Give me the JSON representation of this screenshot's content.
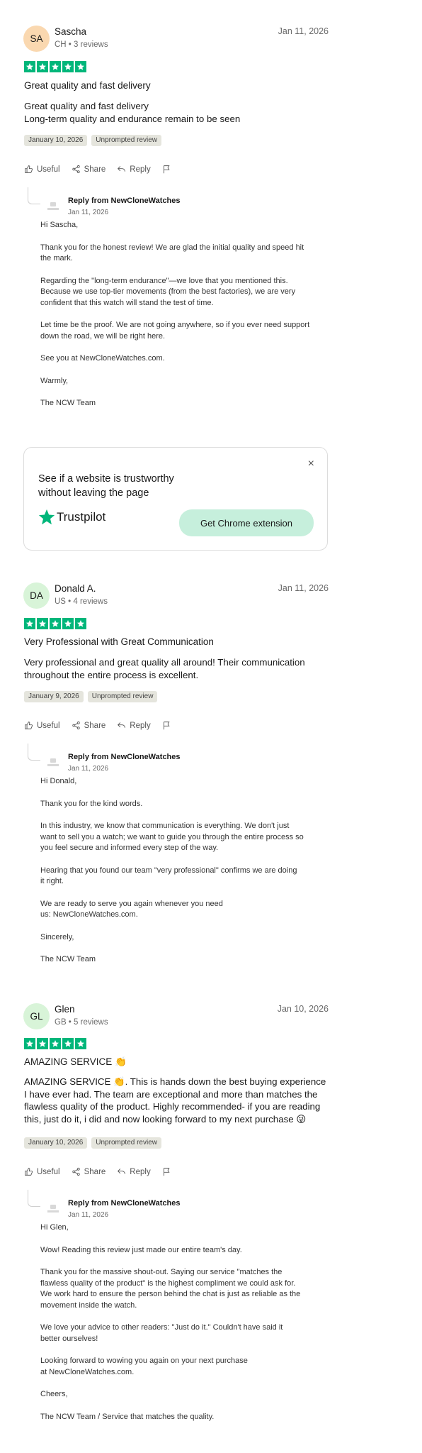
{
  "reviews": [
    {
      "initials": "SA",
      "avatar_color": "#fad8b0",
      "name": "Sascha",
      "meta": "CH • 3 reviews",
      "date": "Jan 11, 2026",
      "rating": 5,
      "title": "Great quality and fast delivery",
      "body": [
        "Great quality and fast delivery",
        "Long-term quality and endurance remain to be seen"
      ],
      "experience_date": "January 10, 2026",
      "tag": "Unprompted review",
      "actions": {
        "useful": "Useful",
        "share": "Share",
        "reply": "Reply"
      },
      "reply": {
        "from": "Reply from NewCloneWatches",
        "date": "Jan 11, 2026",
        "paragraphs": [
          [
            "Hi Sascha,"
          ],
          [
            "Thank you for the honest review! We are glad the initial quality and speed hit",
            "the mark."
          ],
          [
            "Regarding the \"long-term endurance\"—we love that you mentioned this.",
            "Because we use top-tier movements (from the best factories), we are very",
            "confident that this watch will stand the test of time."
          ],
          [
            "Let time be the proof. We are not going anywhere, so if you ever need support",
            "down the road, we will be right here."
          ],
          [
            "See you at NewCloneWatches.com."
          ],
          [
            "Warmly,"
          ],
          [
            "The NCW Team"
          ]
        ]
      }
    },
    {
      "initials": "DA",
      "avatar_color": "#d8f4d8",
      "name": "Donald A.",
      "meta": "US • 4 reviews",
      "date": "Jan 11, 2026",
      "rating": 5,
      "title": "Very Professional with Great Communication",
      "body": [
        "Very professional and great quality all around! Their communication",
        "throughout the entire process is excellent."
      ],
      "experience_date": "January 9, 2026",
      "tag": "Unprompted review",
      "actions": {
        "useful": "Useful",
        "share": "Share",
        "reply": "Reply"
      },
      "reply": {
        "from": "Reply from NewCloneWatches",
        "date": "Jan 11, 2026",
        "paragraphs": [
          [
            "Hi Donald,"
          ],
          [
            "Thank you for the kind words."
          ],
          [
            "In this industry, we know that communication is everything. We don't just",
            "want to sell you a watch; we want to guide you through the entire process so",
            "you feel secure and informed every step of the way."
          ],
          [
            "Hearing that you found our team \"very professional\" confirms we are doing",
            "it right."
          ],
          [
            "We are ready to serve you again whenever you need",
            "us: NewCloneWatches.com."
          ],
          [
            "Sincerely,"
          ],
          [
            "The NCW Team"
          ]
        ]
      }
    },
    {
      "initials": "GL",
      "avatar_color": "#d8f4d8",
      "name": "Glen",
      "meta": "GB • 5 reviews",
      "date": "Jan 10, 2026",
      "rating": 5,
      "title": "AMAZING SERVICE 👏",
      "body": [
        "AMAZING SERVICE 👏. This is hands down the best buying experience",
        "I have ever had. The team are exceptional and more than matches the",
        "flawless quality of the product. Highly recommended- if you are reading",
        "this, just do it, i did and now looking forward to my next purchase 😜"
      ],
      "experience_date": "January 10, 2026",
      "tag": "Unprompted review",
      "actions": {
        "useful": "Useful",
        "share": "Share",
        "reply": "Reply"
      },
      "reply": {
        "from": "Reply from NewCloneWatches",
        "date": "Jan 11, 2026",
        "paragraphs": [
          [
            "Hi Glen,"
          ],
          [
            "Wow! Reading this review just made our entire team's day."
          ],
          [
            "Thank you for the massive shout-out. Saying our service \"matches the",
            "flawless quality of the product\" is the highest compliment we could ask for.",
            "We work hard to ensure the person behind the chat is just as reliable as the",
            "movement inside the watch."
          ],
          [
            "We love your advice to other readers: \"Just do it.\" Couldn't have said it",
            "better ourselves!"
          ],
          [
            "Looking forward to wowing you again on your next purchase",
            "at NewCloneWatches.com."
          ],
          [
            "Cheers,"
          ],
          [
            "The NCW Team / Service that matches the quality."
          ]
        ]
      }
    }
  ],
  "promo": {
    "text_line1": "See if a website is trustworthy",
    "text_line2": "without leaving the page",
    "brand": "Trustpilot",
    "button": "Get Chrome extension",
    "close": "×"
  },
  "colors": {
    "star_green": "#00b67a",
    "button_green": "#c6efdc",
    "tag_bg": "#e5e5dd"
  }
}
